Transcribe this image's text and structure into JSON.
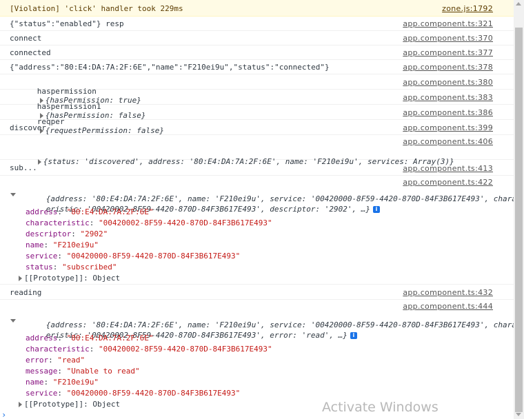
{
  "console": {
    "violation": {
      "text": "[Violation] 'click' handler took 229ms",
      "source": "zone.js:1792"
    },
    "rows": [
      {
        "text": "{\"status\":\"enabled\"} resp",
        "source": "app.component.ts:321"
      },
      {
        "text": "connect",
        "source": "app.component.ts:370"
      },
      {
        "text": "connected",
        "source": "app.component.ts:377"
      },
      {
        "text": "{\"address\":\"80:E4:DA:7A:2F:6E\",\"name\":\"F210ei9u\",\"status\":\"connected\"}",
        "source": "app.component.ts:378"
      }
    ],
    "haspermission": {
      "label": "haspermission",
      "preview": "{hasPermission: true}",
      "source": "app.component.ts:380"
    },
    "haspermission1": {
      "label": "haspermission1",
      "preview": "{hasPermission: false}",
      "source": "app.component.ts:383"
    },
    "reqper": {
      "label": "reqper",
      "preview": "{requestPermission: false}",
      "source": "app.component.ts:386"
    },
    "discover": {
      "text": "discover",
      "source": "app.component.ts:399"
    },
    "discovered": {
      "source": "app.component.ts:406",
      "preview": "{status: 'discovered', address: '80:E4:DA:7A:2F:6E', name: 'F210ei9u', services: Array(3)}"
    },
    "sub": {
      "text": "sub...",
      "source": "app.component.ts:413"
    },
    "subscribed": {
      "source": "app.component.ts:422",
      "preview_line1": "{address: '80:E4:DA:7A:2F:6E', name: 'F210ei9u', service: '00420000-8F59-4420-870D-84F3B617E493', charact",
      "preview_line2": "eristic: '00420002-8F59-4420-870D-84F3B617E493', descriptor: '2902', …}",
      "props": [
        {
          "key": "address",
          "value": "\"80:E4:DA:7A:2F:6E\""
        },
        {
          "key": "characteristic",
          "value": "\"00420002-8F59-4420-870D-84F3B617E493\""
        },
        {
          "key": "descriptor",
          "value": "\"2902\""
        },
        {
          "key": "name",
          "value": "\"F210ei9u\""
        },
        {
          "key": "service",
          "value": "\"00420000-8F59-4420-870D-84F3B617E493\""
        },
        {
          "key": "status",
          "value": "\"subscribed\""
        }
      ],
      "prototype": "[[Prototype]]: Object"
    },
    "reading": {
      "text": "reading",
      "source": "app.component.ts:432"
    },
    "readerror": {
      "source": "app.component.ts:444",
      "preview_line1": "{address: '80:E4:DA:7A:2F:6E', name: 'F210ei9u', service: '00420000-8F59-4420-870D-84F3B617E493', charact",
      "preview_line2": "eristic: '00420002-8F59-4420-870D-84F3B617E493', error: 'read', …}",
      "props": [
        {
          "key": "address",
          "value": "\"80:E4:DA:7A:2F:6E\""
        },
        {
          "key": "characteristic",
          "value": "\"00420002-8F59-4420-870D-84F3B617E493\""
        },
        {
          "key": "error",
          "value": "\"read\""
        },
        {
          "key": "message",
          "value": "\"Unable to read\""
        },
        {
          "key": "name",
          "value": "\"F210ei9u\""
        },
        {
          "key": "service",
          "value": "\"00420000-8F59-4420-870D-84F3B617E493\""
        }
      ],
      "prototype": "[[Prototype]]: Object"
    },
    "info_icon": "i",
    "prompt": "›"
  },
  "watermark": "Activate Windows"
}
